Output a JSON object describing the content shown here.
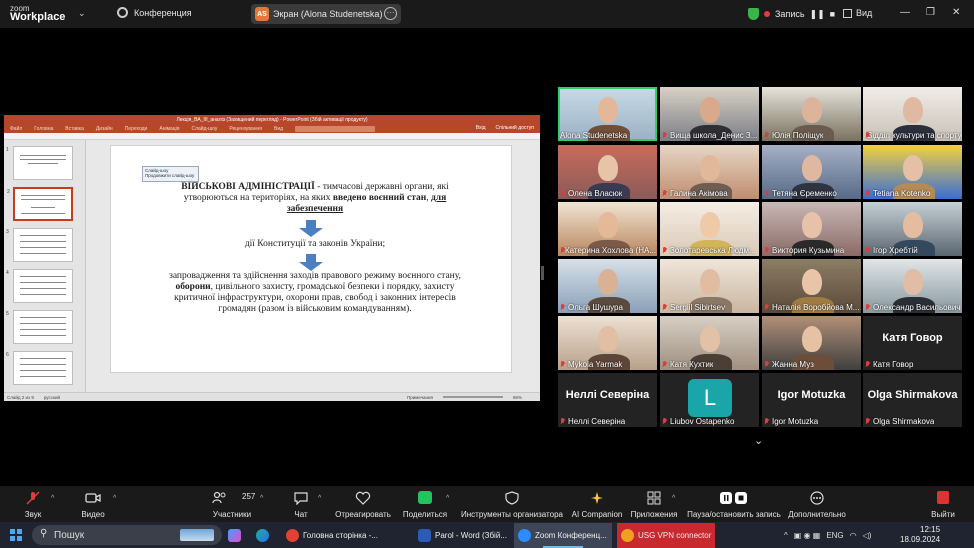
{
  "zoom_titlebar": {
    "logo_line1": "zoom",
    "logo_line2": "Workplace",
    "conference": "Конференция",
    "share_avatar": "AS",
    "share_label": "Экран (Alona Studenetska)",
    "recording_label": "Запись",
    "view_label": "Вид"
  },
  "ppt": {
    "title": "Лекція_ВА_ІІІ_аналіз (Захищений перегляд) - PowerPoint (Збій активації продукту)",
    "ribbon_tabs": [
      "Файл",
      "Головна",
      "Вставка",
      "Дизайн",
      "Переходи",
      "Анімація",
      "Слайд-шоу",
      "Рецензування",
      "Вид"
    ],
    "ribbon_right": [
      "Вхід",
      "Спільний доступ"
    ],
    "slide_toolbar_title": "Слайд-шоу",
    "slide_toolbar_item": "Продовжити слайд-шоу",
    "slide_text": {
      "heading_bold": "ВІЙСЬКОВІ АДМІНІСТРАЦІЇ",
      "heading_rest": " - тимчасові державні органи, які утворюються на  територіях, на яких ",
      "heading_bold2": "введено воєнний стан",
      "heading_comma": ", ",
      "heading_bold3": "для забезпечення",
      "line2": "дії Конституції та законів України;",
      "line3a": "запровадження та здійснення заходів правового режиму воєнного стану, ",
      "line3b": "оборони",
      "line3c": ", цивільного захисту, громадської безпеки і порядку, захисту критичної інфраструктури, охорони прав, свобод і законних інтересів громадян (разом із військовим командуванням)."
    },
    "status_left": "Слайд 2 из 9",
    "status_lang": "русский",
    "status_notes": "Примечания",
    "status_zoom": "86%"
  },
  "gallery": [
    {
      "name": "Alona Studenetska",
      "muted": false,
      "active": true
    },
    {
      "name": "Вища школа_Денис З...",
      "muted": true
    },
    {
      "name": "Юлія Поліщук",
      "muted": true
    },
    {
      "name": "Відділ культури та спорту...",
      "muted": true
    },
    {
      "name": "Олена Власюк",
      "muted": true
    },
    {
      "name": "Галина Акімова",
      "muted": true
    },
    {
      "name": "Тетяна Єременко",
      "muted": true
    },
    {
      "name": "Tetiana Kotenko",
      "muted": true
    },
    {
      "name": "Катерина Хохлова (НА...",
      "muted": true
    },
    {
      "name": "Золотаревська Людм...",
      "muted": true
    },
    {
      "name": "Виктория Кузьмина",
      "muted": true
    },
    {
      "name": "Ігор Хребтій",
      "muted": true
    },
    {
      "name": "Ольга Шушура",
      "muted": true
    },
    {
      "name": "Sergiil Sibirtsev",
      "muted": true
    },
    {
      "name": "Наталія Воробйова М...",
      "muted": true
    },
    {
      "name": "Олександр Васильович",
      "muted": true
    },
    {
      "name": "Mykola Yarmak",
      "muted": true
    },
    {
      "name": "Катя Кухтик",
      "muted": true
    },
    {
      "name": "Жанна Муз",
      "muted": true
    },
    {
      "name": "Катя Говор",
      "big": "Катя Говор",
      "muted": true
    },
    {
      "name": "Неллі Северіна",
      "big": "Неллі Северіна",
      "muted": true
    },
    {
      "name": "Liubov Ostapenko",
      "avatar": "L",
      "muted": true
    },
    {
      "name": "Igor Motuzka",
      "big": "Igor Motuzka",
      "muted": true
    },
    {
      "name": "Olga Shirmakova",
      "big": "Olga Shirmakova",
      "muted": true
    }
  ],
  "toolbar": {
    "audio": "Звук",
    "video": "Видео",
    "participants": "Участники",
    "participants_count": "257",
    "chat": "Чат",
    "react": "Отреагировать",
    "share": "Поделиться",
    "host_tools": "Инструменты организатора",
    "companion": "AI Companion",
    "apps": "Приложения",
    "pause_rec": "Пауза/остановить запись",
    "more": "Дополнительно",
    "leave": "Выйти"
  },
  "taskbar": {
    "search": "Пошук",
    "tasks": [
      "Головна сторінка -...",
      "Parol - Word (Збій...",
      "Zoom Конференц...",
      "USG VPN connector"
    ],
    "lang": "ENG",
    "time": "12:15",
    "date": "18.09.2024"
  },
  "colors": {
    "accent_green": "#2fcf6b",
    "ppt_red": "#b7472a",
    "mute_red": "#e03c3c",
    "arrow_blue": "#4a7fc1"
  }
}
